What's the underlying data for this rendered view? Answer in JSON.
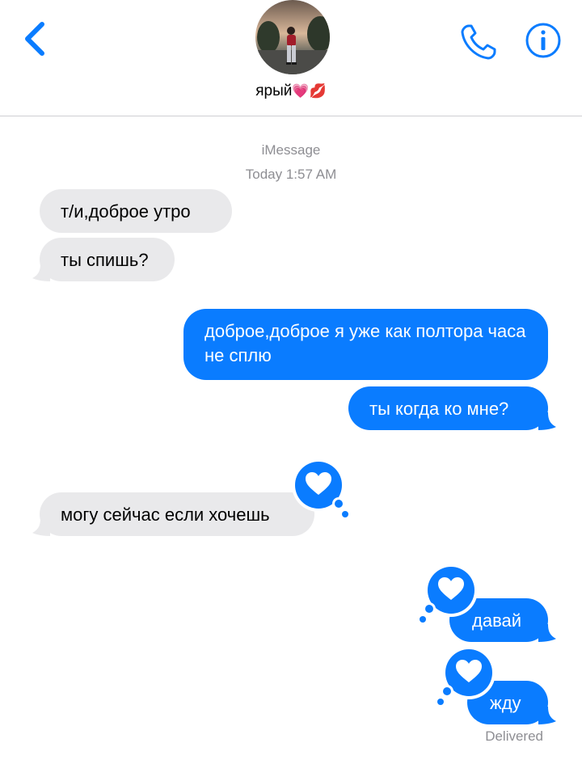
{
  "header": {
    "contact_name": "ярый",
    "name_emojis": "💗💋",
    "back_icon": "chevron-left-icon",
    "call_icon": "phone-icon",
    "info_icon": "info-icon",
    "accent_color": "#0a7cff"
  },
  "conversation": {
    "service": "iMessage",
    "timestamp": "Today 1:57 AM",
    "messages": [
      {
        "from": "them",
        "text": "т/и,доброе утро"
      },
      {
        "from": "them",
        "text": "ты спишь?"
      },
      {
        "from": "me",
        "text": "доброе,доброе я уже как полтора часа не сплю"
      },
      {
        "from": "me",
        "text": "ты когда ко мне?"
      },
      {
        "from": "them",
        "text": "могу сейчас если хочешь",
        "reaction": "heart"
      },
      {
        "from": "me",
        "text": "давай",
        "reaction": "heart"
      },
      {
        "from": "me",
        "text": "жду",
        "reaction": "heart"
      }
    ],
    "status": "Delivered"
  },
  "colors": {
    "incoming_bubble": "#e9e9eb",
    "outgoing_bubble": "#0a7cff",
    "meta_text": "#8e8e93"
  }
}
